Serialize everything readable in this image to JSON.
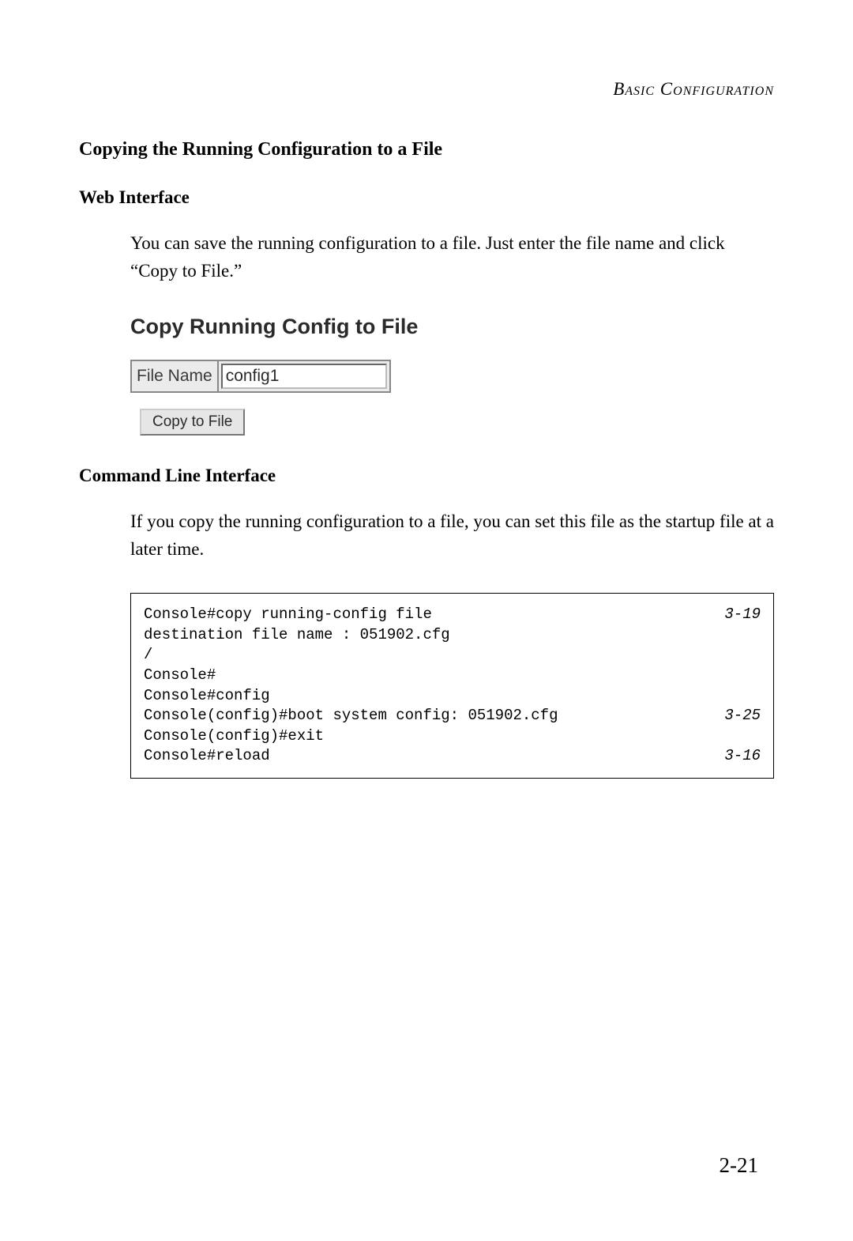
{
  "header": {
    "category": "Basic Configuration"
  },
  "section": {
    "title": "Copying the Running Configuration to a File"
  },
  "web": {
    "heading": "Web Interface",
    "paragraph": "You can save the running configuration to a file. Just enter the file name and click “Copy to File.”",
    "ui": {
      "title": "Copy Running Config to File",
      "field_label": "File Name",
      "field_value": "config1",
      "button_label": "Copy to File"
    }
  },
  "cli": {
    "heading": "Command Line Interface",
    "paragraph": "If you copy the running configuration to a file, you can set this file as the startup file at a later time.",
    "lines": [
      {
        "text": "Console#copy running-config file",
        "ref": "3-19"
      },
      {
        "text": "destination file name : 051902.cfg",
        "ref": ""
      },
      {
        "text": "/",
        "ref": ""
      },
      {
        "text": "Console#",
        "ref": ""
      },
      {
        "text": "Console#config",
        "ref": ""
      },
      {
        "text": "Console(config)#boot system config: 051902.cfg",
        "ref": "3-25"
      },
      {
        "text": "Console(config)#exit",
        "ref": ""
      },
      {
        "text": "Console#reload",
        "ref": "3-16"
      }
    ]
  },
  "page_number": "2-21"
}
